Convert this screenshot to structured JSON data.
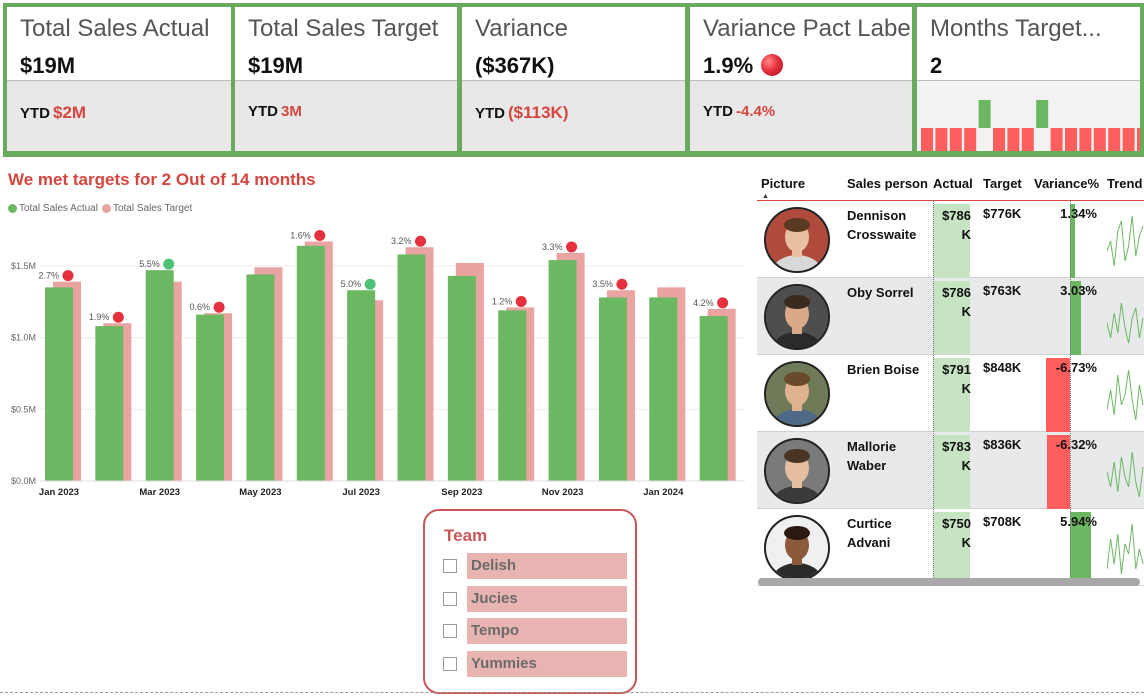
{
  "kpis": [
    {
      "title": "Total Sales Actual",
      "value": "$19M",
      "ytd_label": "YTD",
      "ytd_value": "$2M"
    },
    {
      "title": "Total Sales Target",
      "value": "$19M",
      "ytd_label": "YTD",
      "ytd_value": "3M"
    },
    {
      "title": "Variance",
      "value": "($367K)",
      "ytd_label": "YTD",
      "ytd_value": "($113K)"
    },
    {
      "title": "Variance Pact Label",
      "value": "1.9%",
      "ytd_label": "YTD",
      "ytd_value": "-4.4%",
      "status_icon": "red-dot-icon"
    },
    {
      "title": "Months Target...",
      "value": "2",
      "months_met": [
        0,
        0,
        0,
        0,
        1,
        0,
        0,
        0,
        1,
        0,
        0,
        0,
        0,
        0,
        0,
        0,
        0,
        0
      ]
    }
  ],
  "colors": {
    "met": "#6cb862",
    "missed": "#ff5f5c",
    "target": "#e9a3a1",
    "actual": "#6cb862",
    "accent": "#d4463e",
    "frame": "#6aaa5e"
  },
  "chart": {
    "title": "We met targets for 2 Out of 14 months",
    "legend": [
      "Total Sales Actual",
      "Total Sales Target"
    ]
  },
  "chart_data": {
    "type": "bar",
    "categories": [
      "Jan 2023",
      "Feb 2023",
      "Mar 2023",
      "Apr 2023",
      "May 2023",
      "Jun 2023",
      "Jul 2023",
      "Aug 2023",
      "Sep 2023",
      "Oct 2023",
      "Nov 2023",
      "Dec 2023",
      "Jan 2024",
      "Feb 2024"
    ],
    "x_tick_labels": [
      "Jan 2023",
      "",
      "Mar 2023",
      "",
      "May 2023",
      "",
      "Jul 2023",
      "",
      "Sep 2023",
      "",
      "Nov 2023",
      "",
      "Jan 2024",
      ""
    ],
    "series": [
      {
        "name": "Total Sales Actual",
        "values": [
          1.35,
          1.08,
          1.47,
          1.16,
          1.44,
          1.64,
          1.33,
          1.58,
          1.43,
          1.19,
          1.54,
          1.28,
          1.28,
          1.15
        ]
      },
      {
        "name": "Total Sales Target",
        "values": [
          1.39,
          1.1,
          1.39,
          1.17,
          1.49,
          1.67,
          1.26,
          1.63,
          1.52,
          1.21,
          1.59,
          1.33,
          1.35,
          1.2
        ]
      }
    ],
    "data_labels": [
      "2.7%",
      "1.9%",
      "5.5%",
      "0.6%",
      "",
      "1.6%",
      "5.0%",
      "3.2%",
      "",
      "1.2%",
      "3.3%",
      "3.5%",
      "",
      "4.2%"
    ],
    "label_status": [
      "miss",
      "miss",
      "met",
      "miss",
      "",
      "miss",
      "met",
      "miss",
      "",
      "miss",
      "miss",
      "miss",
      "",
      "miss"
    ],
    "y_tick_labels": [
      "$0.0M",
      "$0.5M",
      "$1.0M",
      "$1.5M"
    ],
    "y_ticks": [
      0,
      0.5,
      1.0,
      1.5
    ],
    "ylim": [
      0,
      1.75
    ],
    "grid": true,
    "legend_position": "top-left"
  },
  "team": {
    "title": "Team",
    "items": [
      "Delish",
      "Jucies",
      "Tempo",
      "Yummies"
    ]
  },
  "table": {
    "columns": [
      "Picture",
      "Sales person",
      "Actual",
      "Target",
      "Variance%",
      "Trend"
    ],
    "rows": [
      {
        "name_line1": "Dennison",
        "name_line2": "Crosswaite",
        "actual_line1": "$786",
        "actual_line2": "K",
        "target": "$776K",
        "variance": "1.34%",
        "variance_value": 1.34
      },
      {
        "name_line1": "Oby Sorrel",
        "name_line2": "",
        "actual_line1": "$786",
        "actual_line2": "K",
        "target": "$763K",
        "variance": "3.03%",
        "variance_value": 3.03
      },
      {
        "name_line1": "Brien Boise",
        "name_line2": "",
        "actual_line1": "$791",
        "actual_line2": "K",
        "target": "$848K",
        "variance": "-6.73%",
        "variance_value": -6.73
      },
      {
        "name_line1": "Mallorie",
        "name_line2": "Waber",
        "actual_line1": "$783",
        "actual_line2": "K",
        "target": "$836K",
        "variance": "-6.32%",
        "variance_value": -6.32
      },
      {
        "name_line1": "Curtice",
        "name_line2": "Advani",
        "actual_line1": "$750",
        "actual_line2": "K",
        "target": "$708K",
        "variance": "5.94%",
        "variance_value": 5.94
      }
    ]
  }
}
